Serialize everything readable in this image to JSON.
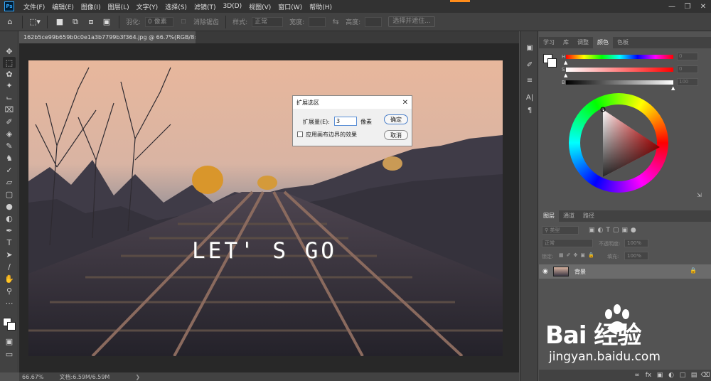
{
  "app": {
    "logo_text": "Ps",
    "menus": [
      "文件(F)",
      "编辑(E)",
      "图像(I)",
      "图层(L)",
      "文字(Y)",
      "选择(S)",
      "滤镜(T)",
      "3D(D)",
      "视图(V)",
      "窗口(W)",
      "帮助(H)"
    ]
  },
  "options_bar": {
    "feather_label": "羽化:",
    "feather_value": "0 像素",
    "antialias_label": "消除锯齿",
    "style_label": "样式:",
    "style_value": "正常",
    "width_label": "宽度:",
    "height_label": "高度:",
    "select_mask_button": "选择并遮住..."
  },
  "document": {
    "tab_title": "162b5ce99b659b0c0e1a3b7799b3f364.jpg @ 66.7%(RGB/8#) *",
    "photo_text": "LET' S GO",
    "status_zoom": "66.67%",
    "status_doc": "文档:6.59M/6.59M"
  },
  "dialog": {
    "title": "扩展选区",
    "expand_label": "扩展量(E):",
    "expand_value": "3",
    "unit": "像素",
    "ok": "确定",
    "cancel": "取消",
    "checkbox_label": "应用画布边界的效果"
  },
  "color_panel": {
    "tabs": [
      "学习",
      "库",
      "调整",
      "颜色",
      "色板"
    ],
    "active_tab": "颜色",
    "h_label": "H",
    "s_label": "S",
    "b_label": "B",
    "h_value": "0",
    "s_value": "0",
    "b_value": "100",
    "h_pct": 0.0,
    "s_pct": 0.0,
    "b_pct": 1.0
  },
  "layers_panel": {
    "tabs": [
      "图层",
      "通道",
      "路径"
    ],
    "active_tab": "图层",
    "kind_filter": "类型",
    "blend_mode": "正常",
    "opacity_label": "不透明度:",
    "opacity_value": "100%",
    "lock_label": "锁定:",
    "fill_label": "填充:",
    "fill_value": "100%",
    "layer_name": "背景"
  },
  "watermark": {
    "brand": "Bai  经验",
    "url": "jingyan.baidu.com"
  },
  "colors": {
    "accent_orange": "#ff8c1a",
    "ps_blue": "#31a8ff"
  }
}
